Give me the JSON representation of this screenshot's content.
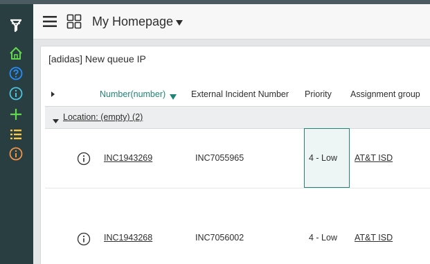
{
  "app": {
    "home_title": "My Homepage"
  },
  "rail": {
    "icons": [
      "filter-icon",
      "home-icon",
      "help-icon",
      "info-icon",
      "plus-icon",
      "list-icon",
      "alert-icon"
    ]
  },
  "widget": {
    "title": "[adidas] New queue IP",
    "columns": {
      "number": "Number(number)",
      "external": "External Incident Number",
      "priority": "Priority",
      "assignment": "Assignment group"
    },
    "group_label": "Location: (empty) (2)",
    "rows": [
      {
        "number": "INC1943269",
        "external": "INC7055965",
        "priority": "4 - Low",
        "assignment": "AT&T ISD"
      },
      {
        "number": "INC1943268",
        "external": "INC7056002",
        "priority": "4 - Low",
        "assignment": "AT&T ISD"
      }
    ]
  },
  "colors": {
    "rail": "#293e40",
    "accent": "#1f8476",
    "rail_green": "#62d84e",
    "rail_blue": "#278efc",
    "rail_cyan": "#4fc3e0",
    "rail_yellow": "#fcc742",
    "rail_orange": "#f2954b"
  }
}
